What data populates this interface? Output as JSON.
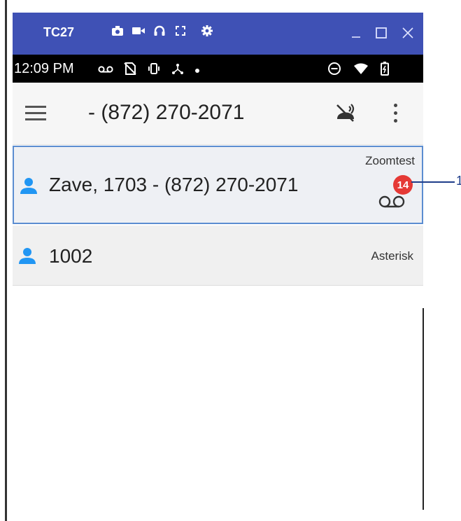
{
  "emulator": {
    "title": "TC27",
    "tool_icons": [
      "camera-icon",
      "video-icon",
      "headset-icon",
      "fullscreen-icon",
      "settings-icon"
    ],
    "window_controls": [
      "minimize-icon",
      "maximize-icon",
      "close-icon"
    ]
  },
  "statusbar": {
    "time": "12:09 PM",
    "left_icons": [
      "voicemail-icon",
      "no-sim-icon",
      "vibrate-icon",
      "network-share-icon",
      "dot-icon"
    ],
    "right_icons": [
      "do-not-disturb-icon",
      "wifi-icon",
      "battery-icon"
    ]
  },
  "appbar": {
    "title": "- (872) 270-2071"
  },
  "contacts": [
    {
      "name": "Zave, 1703 - (872) 270-2071",
      "account": "Zoomtest",
      "voicemail_count": "14",
      "selected": true
    },
    {
      "name": "1002",
      "account": "Asterisk",
      "selected": false
    }
  ],
  "callout": {
    "number": "1"
  },
  "colors": {
    "emulator_bar": "#3f51b5",
    "accent_blue": "#2196f3",
    "badge_red": "#e53935",
    "selection_border": "#5b8dd1"
  }
}
